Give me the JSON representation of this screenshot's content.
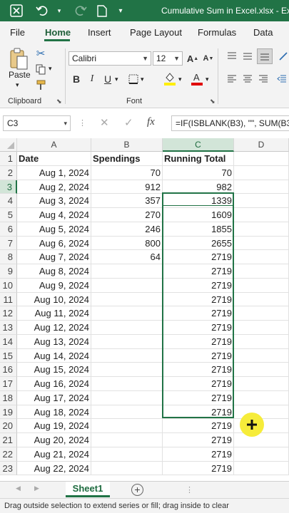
{
  "titlebar": {
    "title": "Cumulative Sum in Excel.xlsx  -  Exc"
  },
  "ribbon_tabs": [
    "File",
    "Home",
    "Insert",
    "Page Layout",
    "Formulas",
    "Data"
  ],
  "clipboard": {
    "paste_label": "Paste",
    "group_label": "Clipboard"
  },
  "font": {
    "name": "Calibri",
    "size": "12",
    "group_label": "Font"
  },
  "formula_bar": {
    "name_box": "C3",
    "formula": "=IF(ISBLANK(B3), \"\", SUM(B3"
  },
  "columns": [
    "A",
    "B",
    "C",
    "D"
  ],
  "headers": {
    "a": "Date",
    "b": "Spendings",
    "c": "Running Total"
  },
  "rows": [
    {
      "n": "1"
    },
    {
      "n": "2",
      "date": "Aug 1, 2024",
      "spend": "70",
      "total": "70"
    },
    {
      "n": "3",
      "date": "Aug 2, 2024",
      "spend": "912",
      "total": "982"
    },
    {
      "n": "4",
      "date": "Aug 3, 2024",
      "spend": "357",
      "total": "1339"
    },
    {
      "n": "5",
      "date": "Aug 4, 2024",
      "spend": "270",
      "total": "1609"
    },
    {
      "n": "6",
      "date": "Aug 5, 2024",
      "spend": "246",
      "total": "1855"
    },
    {
      "n": "7",
      "date": "Aug 6, 2024",
      "spend": "800",
      "total": "2655"
    },
    {
      "n": "8",
      "date": "Aug 7, 2024",
      "spend": "64",
      "total": "2719"
    },
    {
      "n": "9",
      "date": "Aug 8, 2024",
      "spend": "",
      "total": "2719"
    },
    {
      "n": "10",
      "date": "Aug 9, 2024",
      "spend": "",
      "total": "2719"
    },
    {
      "n": "11",
      "date": "Aug 10, 2024",
      "spend": "",
      "total": "2719"
    },
    {
      "n": "12",
      "date": "Aug 11, 2024",
      "spend": "",
      "total": "2719"
    },
    {
      "n": "13",
      "date": "Aug 12, 2024",
      "spend": "",
      "total": "2719"
    },
    {
      "n": "14",
      "date": "Aug 13, 2024",
      "spend": "",
      "total": "2719"
    },
    {
      "n": "15",
      "date": "Aug 14, 2024",
      "spend": "",
      "total": "2719"
    },
    {
      "n": "16",
      "date": "Aug 15, 2024",
      "spend": "",
      "total": "2719"
    },
    {
      "n": "17",
      "date": "Aug 16, 2024",
      "spend": "",
      "total": "2719"
    },
    {
      "n": "18",
      "date": "Aug 17, 2024",
      "spend": "",
      "total": "2719"
    },
    {
      "n": "19",
      "date": "Aug 18, 2024",
      "spend": "",
      "total": "2719"
    },
    {
      "n": "20",
      "date": "Aug 19, 2024",
      "spend": "",
      "total": "2719"
    },
    {
      "n": "21",
      "date": "Aug 20, 2024",
      "spend": "",
      "total": "2719"
    },
    {
      "n": "22",
      "date": "Aug 21, 2024",
      "spend": "",
      "total": "2719"
    },
    {
      "n": "23",
      "date": "Aug 22, 2024",
      "spend": "",
      "total": "2719"
    }
  ],
  "sheet_tabs": [
    "Sheet1"
  ],
  "status": "Drag outside selection to extend series or fill; drag inside to clear",
  "colors": {
    "accent": "#217346",
    "selection_header": "#d2e5d8",
    "cursor_highlight": "#f6ec3a"
  },
  "icons": [
    "excel-logo-icon",
    "undo-icon",
    "redo-icon",
    "new-file-icon",
    "cut-icon",
    "copy-icon",
    "format-painter-icon",
    "bold-icon",
    "italic-icon",
    "underline-icon",
    "borders-icon",
    "fill-color-icon",
    "font-color-icon",
    "align-icon",
    "add-sheet-icon",
    "cross-cursor-icon"
  ]
}
